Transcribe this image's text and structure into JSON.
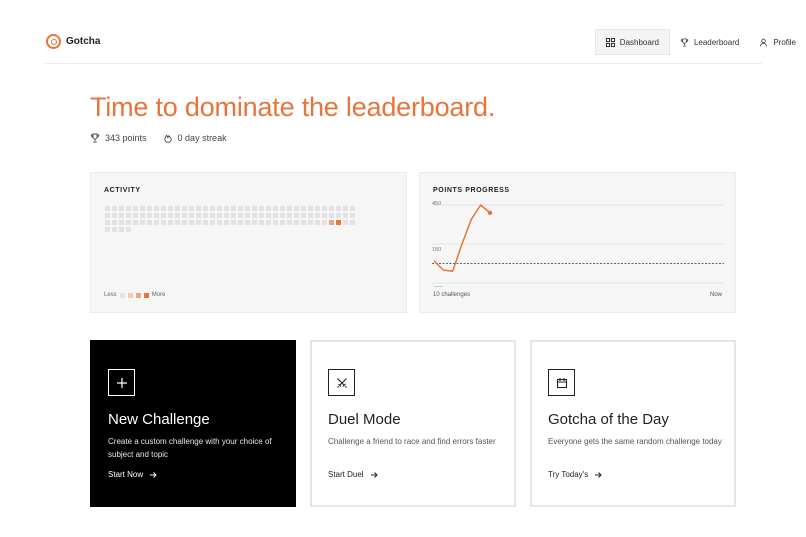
{
  "app": {
    "name": "Gotcha"
  },
  "nav": {
    "items": [
      {
        "label": "Dashboard",
        "icon": "grid-icon",
        "active": true
      },
      {
        "label": "Leaderboard",
        "icon": "trophy-icon",
        "active": false
      },
      {
        "label": "Profile",
        "icon": "user-icon",
        "active": false
      }
    ]
  },
  "hero": {
    "title": "Time to dominate the leaderboard.",
    "points": "343 points",
    "streak": "0 day streak"
  },
  "activity": {
    "title": "ACTIVITY",
    "legend_less": "Less",
    "legend_more": "More",
    "legend_colors": [
      "#e3e3e3",
      "#f3c9b3",
      "#eea57f",
      "#e8743b"
    ],
    "total_cells": 112,
    "active_cells": [
      {
        "index": 104,
        "level": 2
      },
      {
        "index": 105,
        "level": 3
      }
    ]
  },
  "chart_data": {
    "type": "line",
    "title": "POINTS PROGRESS",
    "ytick_labels": [
      "450",
      "150",
      "-150"
    ],
    "ylim": [
      -150,
      450
    ],
    "baseline": 0,
    "x_start_label": "10 challenges",
    "x_end_label": "Now",
    "series": [
      {
        "values": [
          20,
          -50,
          -60,
          150,
          340,
          450,
          390
        ]
      }
    ],
    "color": "#e8743b"
  },
  "cards": [
    {
      "title": "New Challenge",
      "desc": "Create a custom challenge with your choice of subject and topic",
      "link": "Start Now",
      "icon": "plus-icon"
    },
    {
      "title": "Duel Mode",
      "desc": "Challenge a friend to race and find errors faster",
      "link": "Start Duel",
      "icon": "swords-icon"
    },
    {
      "title": "Gotcha of the Day",
      "desc": "Everyone gets the same random challenge today",
      "link": "Try Today's",
      "icon": "calendar-icon"
    }
  ]
}
